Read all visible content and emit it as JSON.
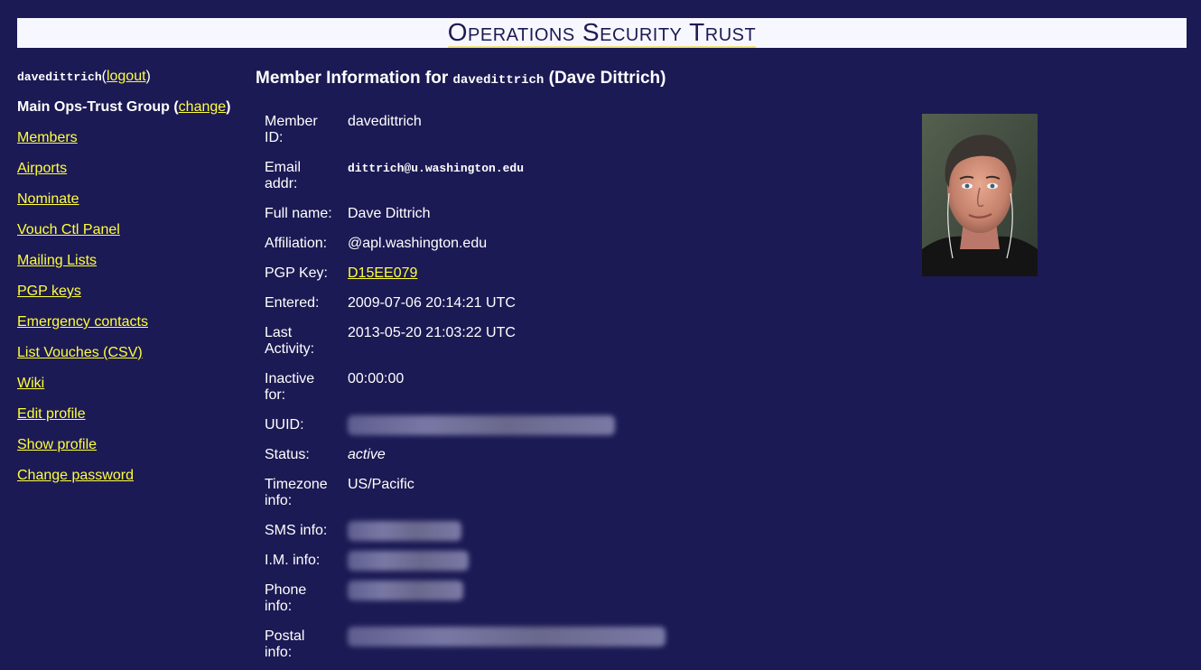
{
  "header": {
    "title": "Operations Security Trust"
  },
  "sidebar": {
    "username": "davedittrich",
    "logout_label": "logout",
    "group_label": "Main Ops-Trust Group",
    "change_label": "change",
    "items": [
      {
        "label": "Members"
      },
      {
        "label": "Airports"
      },
      {
        "label": "Nominate"
      },
      {
        "label": "Vouch Ctl Panel"
      },
      {
        "label": "Mailing Lists"
      },
      {
        "label": "PGP keys"
      },
      {
        "label": "Emergency contacts"
      },
      {
        "label": "List Vouches (CSV)"
      },
      {
        "label": "Wiki"
      },
      {
        "label": "Edit profile"
      },
      {
        "label": "Show profile"
      },
      {
        "label": "Change password"
      }
    ]
  },
  "main": {
    "title_prefix": "Member Information for",
    "title_user": "davedittrich",
    "title_name": "(Dave Dittrich)",
    "fields": {
      "member_id": {
        "label1": "Member",
        "label2": "ID:",
        "value": "davedittrich"
      },
      "email": {
        "label1": "Email",
        "label2": "addr:",
        "value": "dittrich@u.washington.edu"
      },
      "full_name": {
        "label": "Full name:",
        "value": "Dave Dittrich"
      },
      "affiliation": {
        "label": "Affiliation:",
        "value": "@apl.washington.edu"
      },
      "pgp_key": {
        "label": "PGP Key:",
        "value": "D15EE079"
      },
      "entered": {
        "label": "Entered:",
        "value": "2009-07-06 20:14:21 UTC"
      },
      "last_activity": {
        "label1": "Last",
        "label2": "Activity:",
        "value": "2013-05-20 21:03:22 UTC"
      },
      "inactive_for": {
        "label1": "Inactive",
        "label2": "for:",
        "value": "00:00:00"
      },
      "uuid": {
        "label": "UUID:"
      },
      "status": {
        "label": "Status:",
        "value": "active"
      },
      "timezone": {
        "label1": "Timezone",
        "label2": "info:",
        "value": "US/Pacific"
      },
      "sms": {
        "label": "SMS info:"
      },
      "im": {
        "label": "I.M. info:"
      },
      "phone": {
        "label1": "Phone",
        "label2": "info:"
      },
      "postal": {
        "label1": "Postal",
        "label2": "info:"
      }
    }
  },
  "colors": {
    "background": "#1c1a54",
    "link": "#ffff3c",
    "header_bg": "#f7f8ff"
  }
}
